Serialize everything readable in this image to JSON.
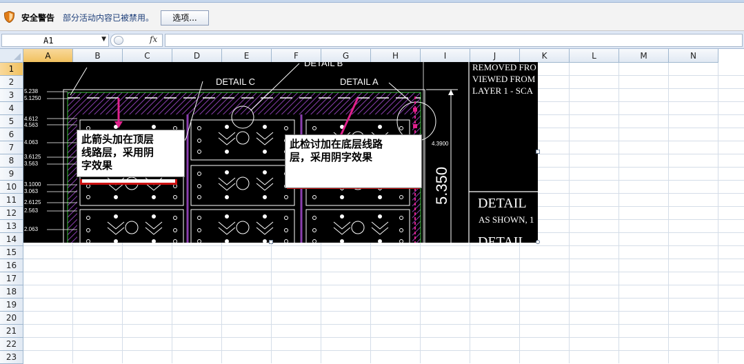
{
  "security_bar": {
    "icon": "shield-icon",
    "title": "安全警告",
    "message": "部分活动内容已被禁用。",
    "options_button": "选项..."
  },
  "formula_bar": {
    "name_box": "A1",
    "fx_label": "fx",
    "formula": ""
  },
  "sheet": {
    "columns": [
      "A",
      "B",
      "C",
      "D",
      "E",
      "F",
      "G",
      "H",
      "I",
      "J",
      "K",
      "L",
      "M",
      "N"
    ],
    "rows": [
      "1",
      "2",
      "3",
      "4",
      "5",
      "6",
      "7",
      "8",
      "9",
      "10",
      "11",
      "12",
      "13",
      "14",
      "15",
      "16",
      "17",
      "18",
      "19",
      "20",
      "21",
      "22",
      "23"
    ],
    "selected_cell": "A1"
  },
  "drawing": {
    "detail_b": "DETAIL B",
    "detail_c": "DETAIL C",
    "detail_a": "DETAIL A",
    "notes": [
      "REMOVED FRO",
      "VIEWED FROM",
      "LAYER 1 - SCA"
    ],
    "dimension_main": "5.350",
    "detail_title": "DETAIL",
    "detail_scale": "AS SHOWN, 1",
    "detail_title_2": "DETAIL",
    "right_dim": "4.3900",
    "left_dims": [
      "5.238",
      "5.1250",
      "4.612",
      "4.563",
      "4.063",
      "3.6125",
      "3.563",
      "3.1000",
      "3.063",
      "2.6125",
      "2.563",
      "2.063"
    ]
  },
  "callouts": {
    "callout1_line1": "此箭头加在顶层",
    "callout1_line2": "线路层，采用阴",
    "callout1_line3": "字效果",
    "callout2_line1": "此检讨加在底层线路",
    "callout2_line2": "层，采用阴字效果"
  },
  "colors": {
    "accent_magenta": "#e0208c",
    "hatch_purple": "#8b3fb0",
    "callout_border_red": "#cc1111",
    "selected_header": "#f5c96b"
  }
}
